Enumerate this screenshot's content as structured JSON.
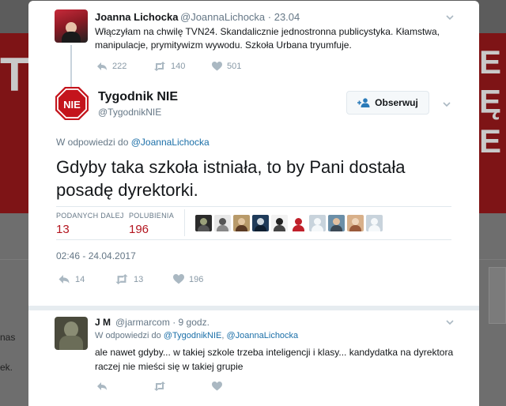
{
  "background": {
    "banner_left": "T",
    "banner_right_lines": [
      "E",
      "Ę",
      "RE"
    ],
    "side_text_1": "nas",
    "side_text_2": "ek."
  },
  "parent_tweet": {
    "name": "Joanna Lichocka",
    "handle": "@JoannaLichocka",
    "time": "· 23.04",
    "text": "Włączyłam na chwilę TVN24. Skandalicznie jednostronna publicystyka. Kłamstwa, manipulacje, prymitywizm wywodu. Szkoła Urbana tryumfuje.",
    "replies": "222",
    "retweets": "140",
    "likes": "501"
  },
  "main_tweet": {
    "avatar_text": "NIE",
    "name": "Tygodnik NIE",
    "handle": "@TygodnikNIE",
    "follow_label": "Obserwuj",
    "reply_to_prefix": "W odpowiedzi do",
    "reply_to_handle": "@JoannaLichocka",
    "text": "Gdyby taka szkoła istniała, to by Pani dostała posadę dyrektorki.",
    "retweets_label": "PODANYCH DALEJ",
    "retweets_value": "13",
    "likes_label": "POLUBIENIA",
    "likes_value": "196",
    "timestamp": "02:46 - 24.04.2017",
    "action_replies": "14",
    "action_retweets": "13",
    "action_likes": "196"
  },
  "reply_tweet": {
    "name": "J M",
    "handle": "@jarmarcom",
    "time": "· 9 godz.",
    "reply_to_prefix": "W odpowiedzi do",
    "reply_to_handle_1": "@TygodnikNIE",
    "reply_to_sep": ",",
    "reply_to_handle_2": "@JoannaLichocka",
    "text": "ale nawet gdyby... w takiej szkole trzeba inteligencji i klasy... kandydatka na dyrektora raczej nie mieści się w takiej grupie"
  },
  "colors": {
    "brand_red": "#b3151f",
    "link_blue": "#1b6fa8",
    "action_gray": "#8899a6"
  }
}
